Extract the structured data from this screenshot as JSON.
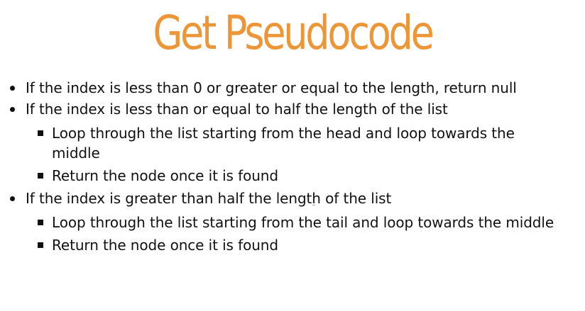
{
  "slide": {
    "title": "Get Pseudocode",
    "bullets": [
      {
        "text": "If the index is less than 0 or greater or equal to the length, return null",
        "sub_bullets": []
      },
      {
        "text": "If the index is less than or equal to half the length of the list",
        "sub_bullets": [
          "Loop through the list starting from the head and loop towards the middle",
          "Return the node once it is found"
        ]
      },
      {
        "text": "If the index is greater than half the length of the list",
        "sub_bullets": [
          "Loop through the list starting from the tail and loop towards the middle",
          "Return the node once it is found"
        ]
      }
    ],
    "colors": {
      "title": "#ed9638",
      "body_text": "#111111",
      "background": "#ffffff"
    }
  }
}
